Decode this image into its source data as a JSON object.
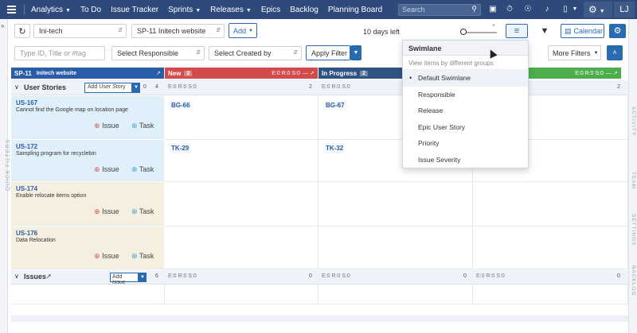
{
  "nav": {
    "items": [
      {
        "label": "Analytics",
        "caret": true
      },
      {
        "label": "To Do",
        "caret": false
      },
      {
        "label": "Issue Tracker",
        "caret": false
      },
      {
        "label": "Sprints",
        "caret": true
      },
      {
        "label": "Releases",
        "caret": true
      },
      {
        "label": "Epics",
        "caret": false
      },
      {
        "label": "Backlog",
        "caret": false
      },
      {
        "label": "Planning Board",
        "caret": false
      }
    ],
    "search_placeholder": "Search",
    "avatar_initials": "LJ"
  },
  "toolbar": {
    "project": "Ini-tech",
    "sprint": "SP-11 Initech website",
    "add_label": "Add",
    "days_left": "10 days left",
    "calendar_label": "Calendar"
  },
  "filters": {
    "search_placeholder": "Type ID, Title or #tag",
    "responsible": "Select Responsible",
    "created_by": "Select Created by",
    "apply_label": "Apply Filter",
    "more_filters_label": "More Filters"
  },
  "board": {
    "sprint_col": {
      "title": "SP-11",
      "subtitle": "Initech website"
    },
    "columns": [
      {
        "name": "New",
        "count": "2",
        "stats": "E:0  R:0  S:0",
        "color": "#d24a4a"
      },
      {
        "name": "In Progress",
        "count": "2",
        "color": "#2f5483"
      },
      {
        "name": "",
        "count": "",
        "stats": "E:0  R:0  S:0",
        "color": "#4cae4c"
      }
    ],
    "story_lane": {
      "label": "User Stories",
      "add_label": "Add User Story",
      "count_a": "0",
      "count_b": "4",
      "col_count_new": "2",
      "col_count_last": "2",
      "stats": "E:0   R:0   S:0"
    },
    "stories": [
      {
        "id": "US-167",
        "desc": "Cannot find the Google map on location page",
        "new_tag": "BG-66",
        "ip_tag": "BG-67"
      },
      {
        "id": "US-172",
        "desc": "Sampling program for recyclebin",
        "new_tag": "TK-29",
        "ip_tag": "TK-32"
      },
      {
        "id": "US-174",
        "desc": "Enable relocate items option",
        "new_tag": "",
        "ip_tag": ""
      },
      {
        "id": "US-176",
        "desc": "Data Relocation",
        "new_tag": "",
        "ip_tag": ""
      }
    ],
    "issue_label": "Issue",
    "task_label": "Task",
    "issues_lane": {
      "label": "Issues",
      "add_label": "Add Issue",
      "count": "6",
      "stats": "E:0   R:0   S:0",
      "zero": "0"
    }
  },
  "swimlane": {
    "title": "Swimlane",
    "subtitle": "View items by different groups",
    "options": [
      "Default Swimlane",
      "Responsible",
      "Release",
      "Epic User Story",
      "Priority",
      "Issue Severity"
    ],
    "selected": "Default Swimlane"
  },
  "rails": {
    "left_label": "QUICK FILTERS",
    "right_labels": [
      "ACTIVITY",
      "TEAM",
      "SETTINGS",
      "BACKLOG"
    ]
  },
  "colors": {
    "nav_bg": "#2d4a7a",
    "new": "#d24a4a",
    "in_progress": "#2f5483",
    "done": "#4cae4c",
    "accent": "#2a6ab1"
  }
}
